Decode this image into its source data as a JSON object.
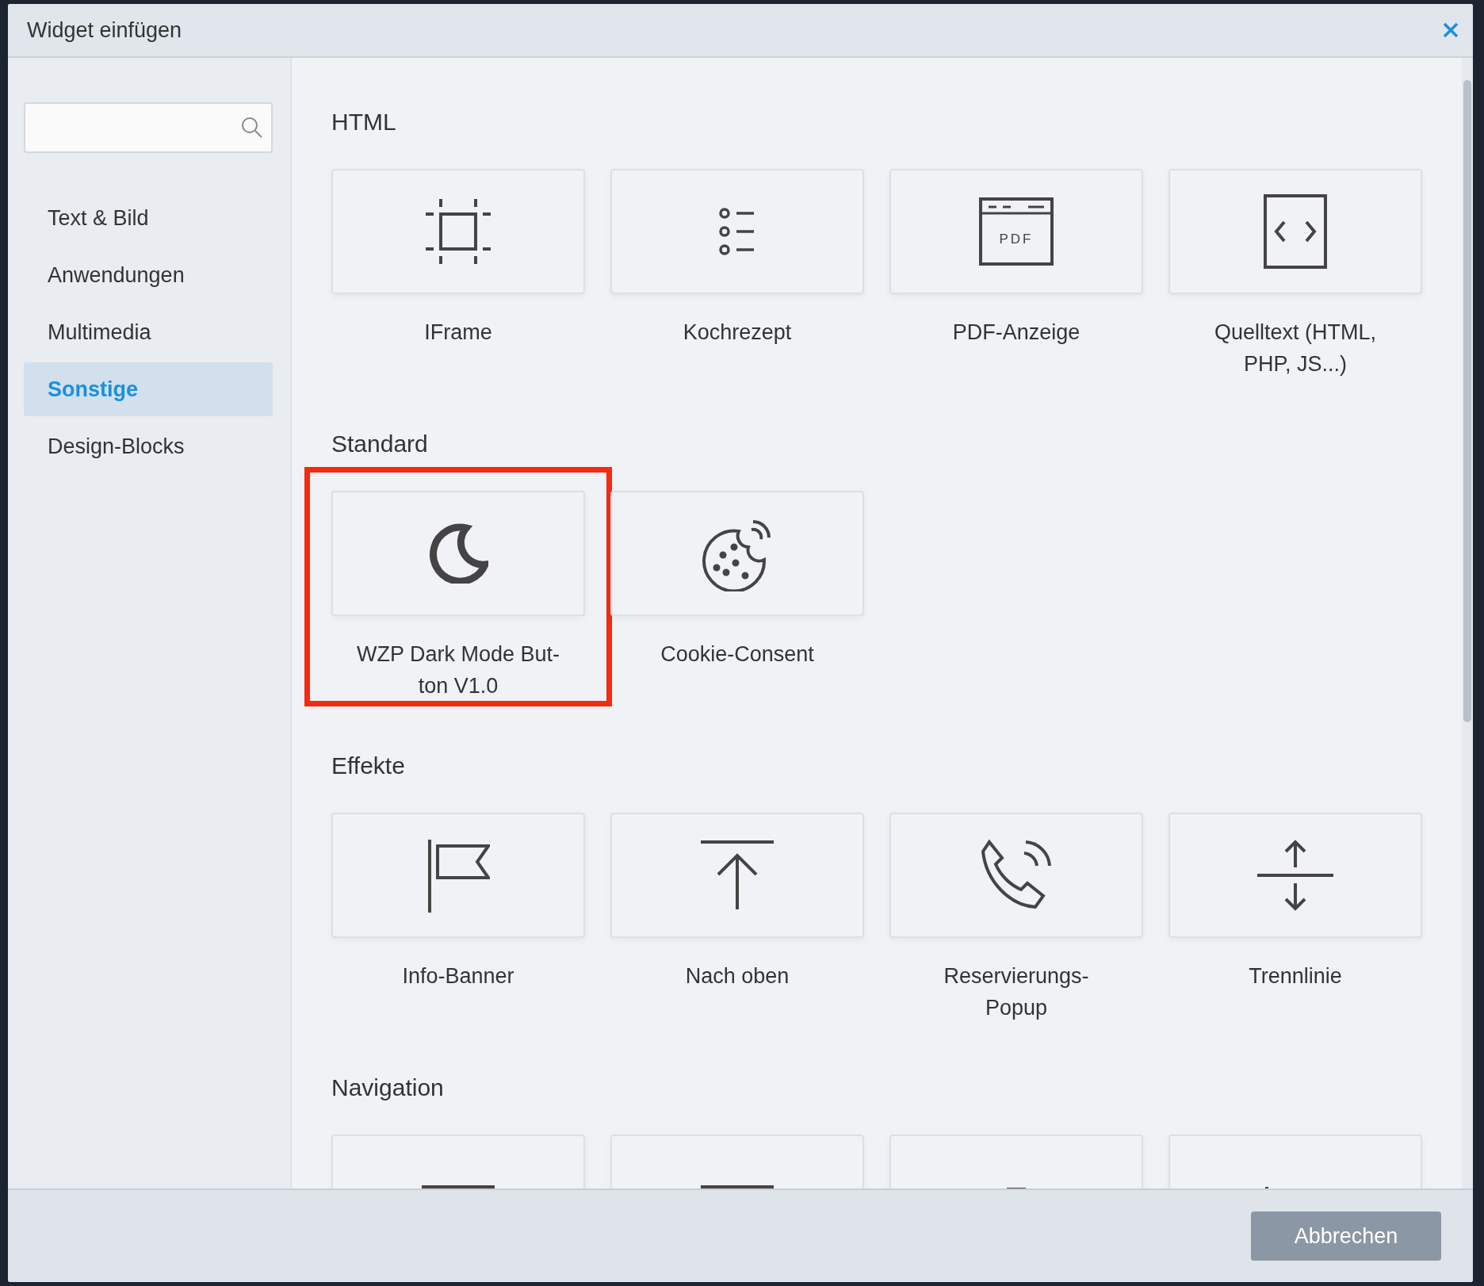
{
  "window": {
    "title": "Widget einfügen"
  },
  "sidebar": {
    "items": [
      {
        "label": "Text & Bild",
        "selected": false
      },
      {
        "label": "Anwendungen",
        "selected": false
      },
      {
        "label": "Multimedia",
        "selected": false
      },
      {
        "label": "Sonstige",
        "selected": true
      },
      {
        "label": "Design-Blocks",
        "selected": false
      }
    ]
  },
  "sections": [
    {
      "title": "HTML",
      "tiles": [
        {
          "label": "IFrame",
          "highlighted": false
        },
        {
          "label": "Kochrezept",
          "highlighted": false
        },
        {
          "label": "PDF-Anzeige",
          "icon_text": "PDF",
          "highlighted": false
        },
        {
          "label": "Quelltext (HTML, PHP, JS...)",
          "highlighted": false
        }
      ]
    },
    {
      "title": "Standard",
      "tiles": [
        {
          "label": "WZP Dark Mode But-ton V1.0",
          "highlighted": true
        },
        {
          "label": "Cookie-Consent",
          "highlighted": false
        }
      ]
    },
    {
      "title": "Effekte",
      "tiles": [
        {
          "label": "Info-Banner",
          "highlighted": false
        },
        {
          "label": "Nach oben",
          "highlighted": false
        },
        {
          "label": "Reservierungs-Popup",
          "highlighted": false
        },
        {
          "label": "Trennlinie",
          "highlighted": false
        }
      ]
    },
    {
      "title": "Navigation",
      "tiles": [
        {
          "highlighted": false
        },
        {
          "highlighted": false
        },
        {
          "highlighted": false
        },
        {
          "highlighted": false
        }
      ]
    }
  ],
  "footer": {
    "buttons": [
      "Abbrechen"
    ]
  }
}
